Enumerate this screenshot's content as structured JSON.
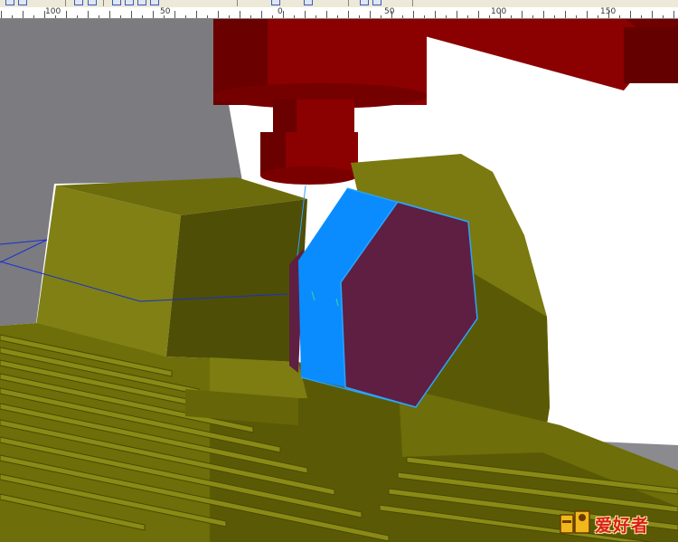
{
  "ruler": {
    "labels": [
      "100",
      "50",
      "0",
      "50",
      "100",
      "150"
    ]
  },
  "logo": {
    "text": "爱好者",
    "icon": "machinist-logo-icon"
  },
  "colors": {
    "fixture_olive": "#7a7a10",
    "fixture_shadow": "#4b4b06",
    "spindle_red": "#8b0000",
    "part_blue": "#0a8cff",
    "part_maroon": "#5e1f42",
    "toolpath_blue": "#1a2fd0",
    "background_gray": "#7b7b80"
  }
}
